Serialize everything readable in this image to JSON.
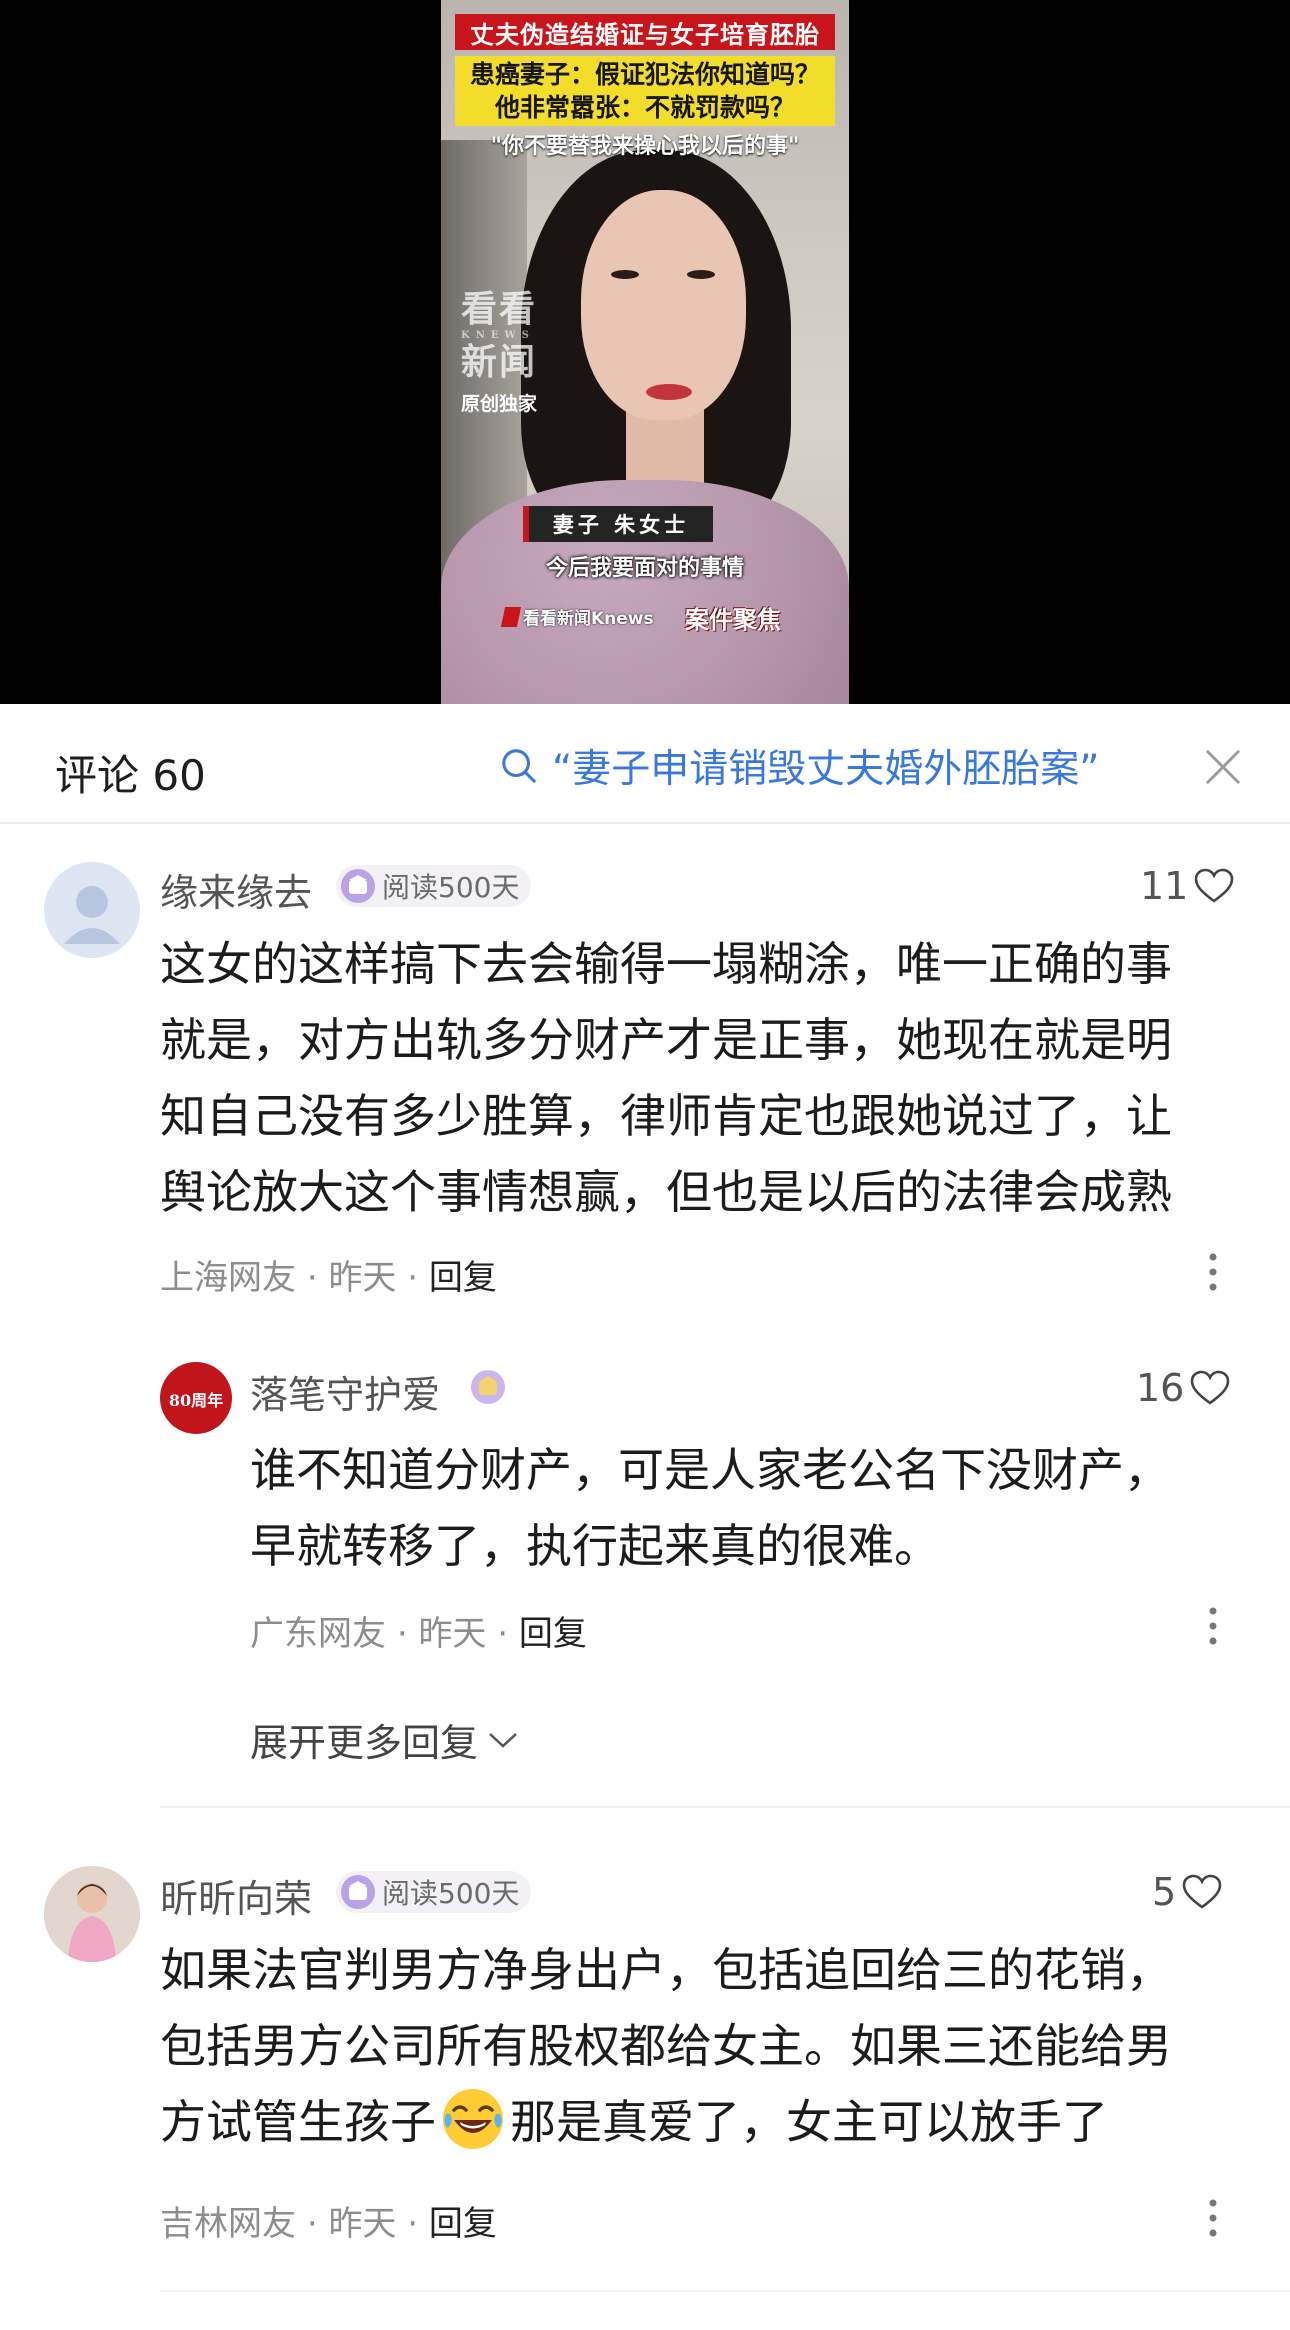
{
  "video": {
    "headline_red": "丈夫伪造结婚证与女子培育胚胎",
    "headline_yellow_1": "患癌妻子：假证犯法你知道吗？",
    "headline_yellow_2": "他非常嚣张：不就罚款吗？",
    "headline_quote": "\"你不要替我来操心我以后的事\"",
    "watermark_big_1": "看看",
    "watermark_knews": "KNEWS",
    "watermark_big_2": "新闻",
    "watermark_small": "原创独家",
    "name_tag": "妻子 朱女士",
    "subtitle": "今后我要面对的事情",
    "logo_knews": "看看新闻Knews",
    "logo_case": "案件聚焦"
  },
  "comments_header": {
    "title": "评论 60",
    "search_query": "“妻子申请销毁丈夫婚外胚胎案”"
  },
  "comments": [
    {
      "username": "缘来缘去",
      "badge": "阅读500天",
      "likes": "11",
      "lines": [
        "这女的这样搞下去会输得一塌糊涂，唯一正确的事",
        "就是，对方出轨多分财产才是正事，她现在就是明",
        "知自己没有多少胜算，律师肯定也跟她说过了，让",
        "舆论放大这个事情想赢，但也是以后的法律会成熟"
      ],
      "location": "上海网友",
      "time": "昨天",
      "reply": "回复"
    },
    {
      "username": "落笔守护爱",
      "avatar_text": "80周年",
      "likes": "16",
      "lines": [
        "谁不知道分财产，可是人家老公名下没财产，",
        "早就转移了，执行起来真的很难。"
      ],
      "location": "广东网友",
      "time": "昨天",
      "reply": "回复",
      "expand_label": "展开更多回复"
    },
    {
      "username": "昕昕向荣",
      "badge": "阅读500天",
      "likes": "5",
      "lines": [
        "如果法官判男方净身出户，包括追回给三的花销，",
        "包括男方公司所有股权都给女主。如果三还能给男"
      ],
      "line3_before": "方试管生孩子",
      "line3_after": "那是真爱了，女主可以放手了",
      "location": "吉林网友",
      "time": "昨天",
      "reply": "回复"
    }
  ],
  "colors": {
    "accent_blue": "#3978e0",
    "headline_red": "#c8151b",
    "headline_yellow": "#f3dd2b"
  }
}
